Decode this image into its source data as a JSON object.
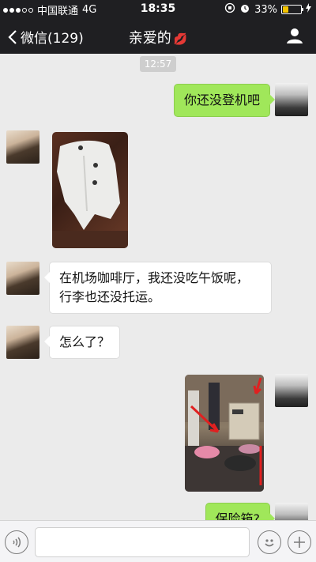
{
  "status": {
    "carrier": "中国联通",
    "network": "4G",
    "time": "18:35",
    "battery": "33%",
    "battery_level": 0.33
  },
  "nav": {
    "back_label": "微信(129)",
    "title": "亲爱的",
    "title_emoji": "💋"
  },
  "chat": {
    "timestamp": "12:57",
    "messages": [
      {
        "from": "me",
        "type": "text",
        "text": "你还没登机吧"
      },
      {
        "from": "her",
        "type": "image",
        "image": "white-coat-photo"
      },
      {
        "from": "her",
        "type": "text",
        "text_line1": "在机场咖啡厅，我还没吃午饭呢，",
        "text_line2": "行李也还没托运。"
      },
      {
        "from": "her",
        "type": "text",
        "text": "怎么了？"
      },
      {
        "from": "me",
        "type": "image",
        "image": "room-safe-photo"
      },
      {
        "from": "me",
        "type": "text",
        "text": "保险箱?"
      }
    ]
  },
  "colors": {
    "bar_bg": "#1f1f22",
    "chat_bg": "#ebebeb",
    "my_bubble": "#a0e75a",
    "their_bubble": "#ffffff",
    "lips": "#d81e3c"
  },
  "icons": {
    "voice": "voice-icon",
    "emoji": "emoji-icon",
    "plus": "plus-icon",
    "person": "person-icon",
    "back": "chevron-left-icon"
  }
}
